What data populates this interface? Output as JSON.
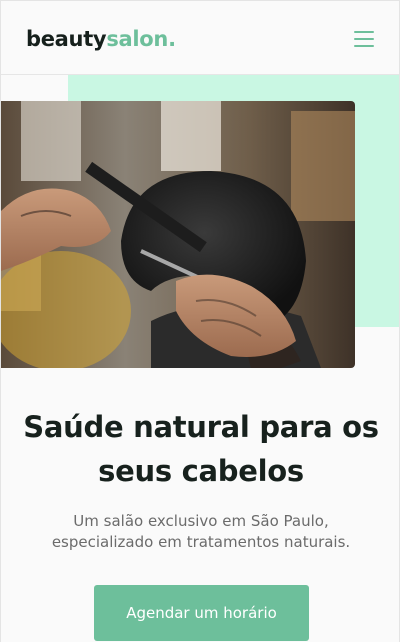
{
  "header": {
    "logo_main": "beauty",
    "logo_accent": "salon.",
    "menu_icon": "hamburger-menu-icon"
  },
  "hero": {
    "image_subject": "barber cutting hair with comb and scissors",
    "headline": "Saúde natural para os seus cabelos",
    "subtitle": "Um salão exclusivo em São Paulo, especializado em tratamentos naturais.",
    "cta_label": "Agendar um horário"
  },
  "colors": {
    "accent": "#6dbf9b",
    "mint_background": "#c9f7e3",
    "text_dark": "#17211d",
    "text_muted": "#6b6b6b"
  }
}
